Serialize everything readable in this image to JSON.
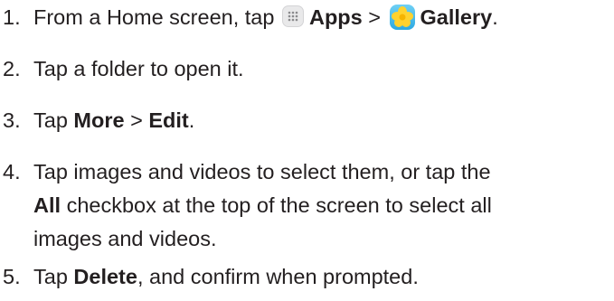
{
  "steps": [
    {
      "number": "1.",
      "text_1": "From a Home screen, tap",
      "bold_1": "Apps",
      "sep": ">",
      "bold_2": "Gallery",
      "end": ".",
      "icon_1": "apps-grid-icon",
      "icon_2": "gallery-flower-icon"
    },
    {
      "number": "2.",
      "text": "Tap a folder to open it."
    },
    {
      "number": "3.",
      "text_1": "Tap",
      "bold_1": "More",
      "sep": ">",
      "bold_2": "Edit",
      "end": "."
    },
    {
      "number": "4.",
      "line_1": "Tap images and videos to select them, or tap the",
      "bold_1": "All",
      "line_2_rest": "checkbox at the top of the screen to select all",
      "line_3": "images and videos."
    },
    {
      "number": "5.",
      "text_1": "Tap",
      "bold_1": "Delete",
      "text_2": ", and confirm when prompted."
    }
  ]
}
